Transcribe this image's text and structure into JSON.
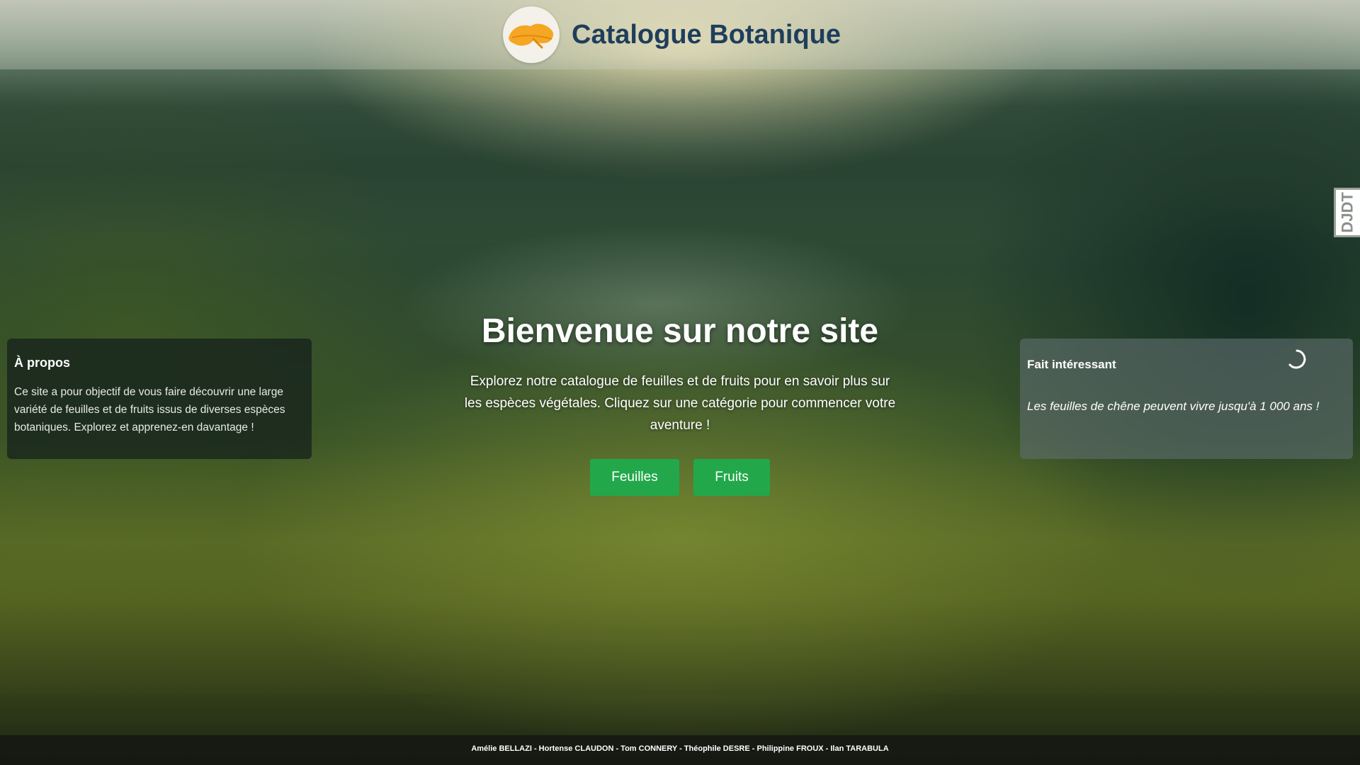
{
  "header": {
    "title": "Catalogue Botanique",
    "logo_icon": "orange-leaf-icon"
  },
  "hero": {
    "title": "Bienvenue sur notre site",
    "description": "Explorez notre catalogue de feuilles et de fruits pour en savoir plus sur les espèces végétales. Cliquez sur une catégorie pour commencer votre aventure !",
    "buttons": {
      "leaves": "Feuilles",
      "fruits": "Fruits"
    }
  },
  "about": {
    "title": "À propos",
    "text": "Ce site a pour objectif de vous faire découvrir une large variété de feuilles et de fruits issus de diverses espèces botaniques. Explorez et apprenez-en davantage !"
  },
  "fact": {
    "title": "Fait intéressant",
    "text": "Les feuilles de chêne peuvent vivre jusqu'à 1 000 ans !",
    "loading_icon": "loading-spinner-icon"
  },
  "debug_toolbar": {
    "label": "DJDT"
  },
  "footer": {
    "credits": "Amélie BELLAZI - Hortense CLAUDON - Tom CONNERY - Théophile DESRE - Philippine FROUX - Ilan TARABULA"
  },
  "colors": {
    "title_blue": "#1f3e5c",
    "button_green": "#22a84a",
    "logo_orange": "#f5a623"
  }
}
